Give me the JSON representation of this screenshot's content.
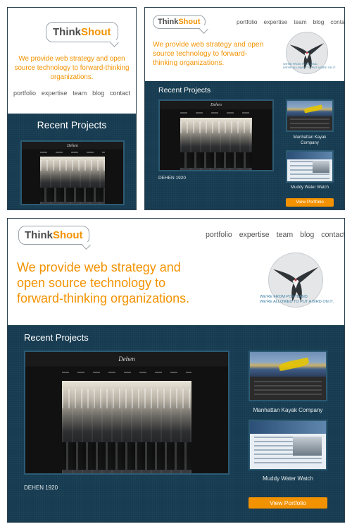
{
  "brand": {
    "think": "Think",
    "shout": "Shout"
  },
  "tagline": "We provide web strategy and open source technology to forward-thinking organizations.",
  "nav": [
    "portfolio",
    "expertise",
    "team",
    "blog",
    "contact"
  ],
  "mobile_nav": [
    "portfolio",
    "expertise",
    "team",
    "blog",
    "contact"
  ],
  "bird_caption": {
    "line1": "WE'RE FROM PORTLAND.",
    "line2": "WE'RE ALLOWED TO PUT A BIRD ON IT."
  },
  "recent_projects": "Recent Projects",
  "projects": [
    {
      "name": "DEHEN 1920",
      "brand": "Dehen"
    },
    {
      "name": "Manhattan Kayak Company"
    },
    {
      "name": "Muddy Water Watch"
    }
  ],
  "view_portfolio": "View Portfolio",
  "colors": {
    "accent": "#f39200",
    "dark_bg": "#163b50",
    "bird_text": "#3d7fa5"
  }
}
